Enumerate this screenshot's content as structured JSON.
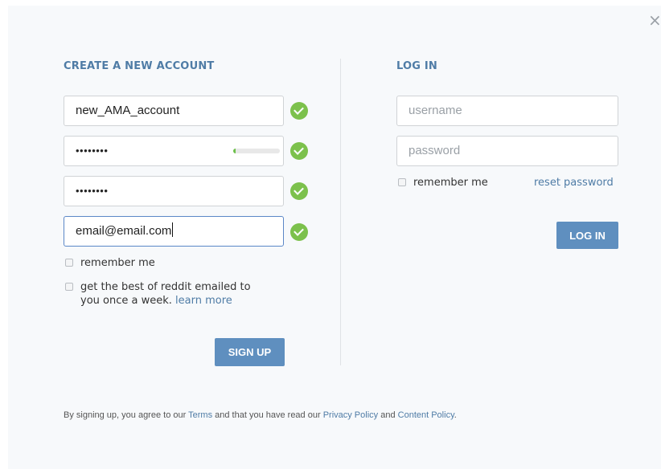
{
  "close_label": "×",
  "signup": {
    "heading": "CREATE A NEW ACCOUNT",
    "username_value": "new_AMA_account",
    "password_value": "••••••••",
    "password_strength": 0.06,
    "verify_password_value": "••••••••",
    "email_value": "email@email.com",
    "remember_me_label": "remember me",
    "newsletter_text": "get the best of reddit emailed to you once a week.",
    "learn_more_label": "learn more",
    "submit_label": "SIGN UP"
  },
  "login": {
    "heading": "LOG IN",
    "username_placeholder": "username",
    "password_placeholder": "password",
    "remember_me_label": "remember me",
    "reset_password_label": "reset password",
    "submit_label": "LOG IN"
  },
  "footer": {
    "prefix": "By signing up, you agree to our",
    "terms_label": "Terms",
    "middle": "and that you have read our",
    "privacy_label": "Privacy Policy",
    "and": "and",
    "content_policy_label": "Content Policy",
    "suffix": "."
  },
  "colors": {
    "accent": "#4f7ca6",
    "button": "#5f8fbf",
    "check": "#7cc14c"
  }
}
